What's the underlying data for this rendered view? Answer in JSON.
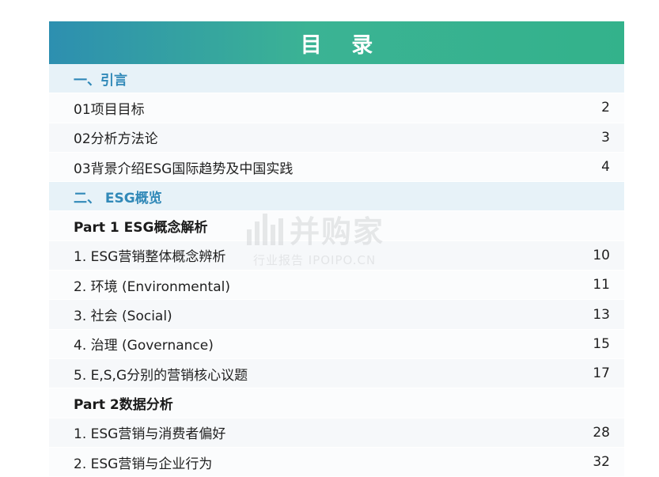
{
  "header": {
    "title": "目 录"
  },
  "sections": [
    {
      "label": "一、引言"
    },
    {
      "label": "二、 ESG概览"
    }
  ],
  "intro_items": [
    {
      "label": "01项目目标",
      "page": "2"
    },
    {
      "label": "02分析方法论",
      "page": "3"
    },
    {
      "label": "03背景介绍ESG国际趋势及中国实践",
      "page": "4"
    }
  ],
  "parts": [
    {
      "label": "Part 1 ESG概念解析"
    },
    {
      "label": "Part 2数据分析"
    }
  ],
  "part1_items": [
    {
      "label": "1. ESG营销整体概念辨析",
      "page": "10"
    },
    {
      "label": "2. 环境 (Environmental)",
      "page": "11"
    },
    {
      "label": "3. 社会 (Social)",
      "page": "13"
    },
    {
      "label": "4. 治理 (Governance)",
      "page": "15"
    },
    {
      "label": "5. E,S,G分别的营销核心议题",
      "page": "17"
    }
  ],
  "part2_items": [
    {
      "label": "1. ESG营销与消费者偏好",
      "page": "28"
    },
    {
      "label": "2. ESG营销与企业行为",
      "page": "32"
    }
  ],
  "watermark": {
    "brand": "并购家",
    "subtitle": "行业报告 IPOIPO.CN"
  }
}
